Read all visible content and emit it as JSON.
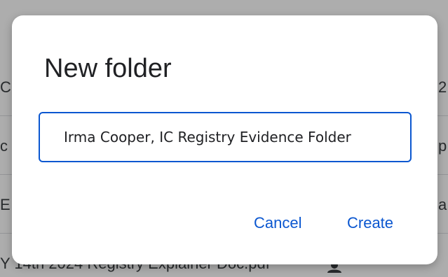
{
  "background": {
    "rows": [
      {
        "left_fragment": "C",
        "right_fragment": "2"
      },
      {
        "left_fragment": "c",
        "right_fragment": "p"
      },
      {
        "left_fragment": "E",
        "right_fragment": "a"
      }
    ],
    "bottom_text": "Y 14th 2024 Registry Explainer Doc.pdf",
    "bottom_icon": "person-icon"
  },
  "dialog": {
    "title": "New folder",
    "input": {
      "value": "Irma Cooper, IC Registry Evidence Folder",
      "placeholder": ""
    },
    "buttons": {
      "cancel": "Cancel",
      "create": "Create"
    }
  },
  "colors": {
    "accent": "#0b57d0",
    "text": "#202124",
    "scrim": "rgba(0,0,0,0.32)"
  }
}
